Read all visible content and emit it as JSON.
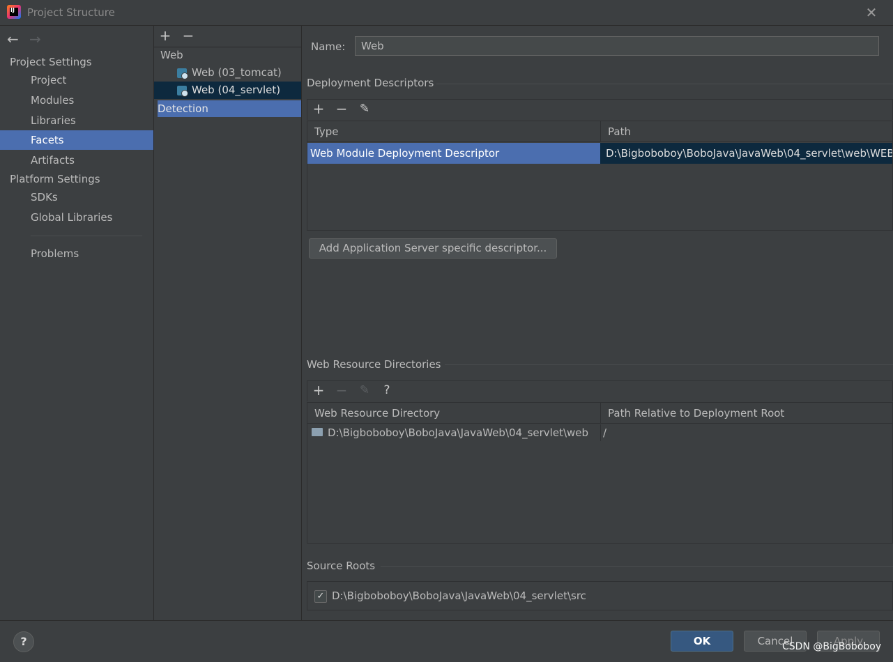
{
  "window": {
    "title": "Project Structure"
  },
  "nav": {
    "back_arrow": "←",
    "forward_arrow": "→",
    "project_settings_title": "Project Settings",
    "project_items": [
      {
        "label": "Project"
      },
      {
        "label": "Modules"
      },
      {
        "label": "Libraries"
      },
      {
        "label": "Facets",
        "selected": true
      },
      {
        "label": "Artifacts"
      }
    ],
    "platform_settings_title": "Platform Settings",
    "platform_items": [
      {
        "label": "SDKs"
      },
      {
        "label": "Global Libraries"
      }
    ],
    "problems_label": "Problems"
  },
  "facets_tree": {
    "add_symbol": "+",
    "remove_symbol": "−",
    "group_label": "Web",
    "items": [
      {
        "label": "Web (03_tomcat)"
      },
      {
        "label": "Web (04_servlet)",
        "selected": true
      }
    ],
    "detection_label": "Detection"
  },
  "detail": {
    "name_label": "Name:",
    "name_value": "Web",
    "deployment": {
      "title": "Deployment Descriptors",
      "col_type": "Type",
      "col_path": "Path",
      "rows": [
        {
          "type": "Web Module Deployment Descriptor",
          "path": "D:\\Bigboboboy\\BoboJava\\JavaWeb\\04_servlet\\web\\WEB"
        }
      ],
      "add_server_button": "Add Application Server specific descriptor..."
    },
    "resources": {
      "title": "Web Resource Directories",
      "help_symbol": "?",
      "col_dir": "Web Resource Directory",
      "col_rel": "Path Relative to Deployment Root",
      "rows": [
        {
          "dir": "D:\\Bigboboboy\\BoboJava\\JavaWeb\\04_servlet\\web",
          "rel": "/"
        }
      ]
    },
    "sources": {
      "title": "Source Roots",
      "items": [
        {
          "path": "D:\\Bigboboboy\\BoboJava\\JavaWeb\\04_servlet\\src",
          "checked": true
        }
      ]
    }
  },
  "footer": {
    "help_symbol": "?",
    "ok_label": "OK",
    "cancel_label": "Cancel",
    "apply_label": "Apply",
    "watermark": "CSDN @BigBoboboy"
  },
  "colors": {
    "background": "#3c3f41",
    "selection": "#4b6eaf",
    "tree_selection": "#0d293e",
    "ok_button": "#365880"
  }
}
